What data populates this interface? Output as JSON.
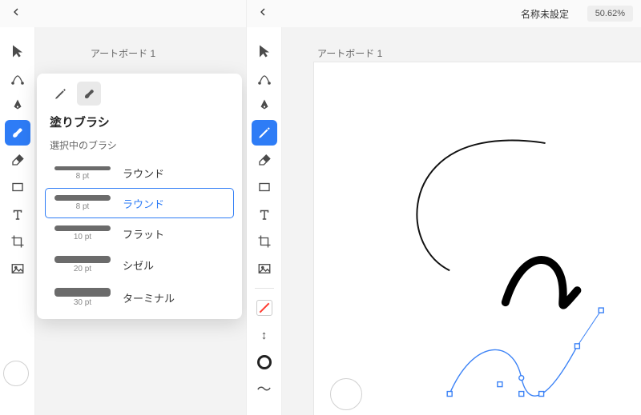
{
  "left": {
    "artboard_label": "アートボード 1",
    "toolbar": {
      "tools": [
        "selection",
        "pen-curvature",
        "pen",
        "blob-brush",
        "eraser",
        "rectangle",
        "type",
        "crop",
        "image"
      ],
      "selected": "blob-brush"
    },
    "popover": {
      "tabs": {
        "pencil": "pencil-icon",
        "blob": "blob-brush-icon",
        "active": "blob"
      },
      "title": "塗りブラシ",
      "subtitle": "選択中のブラシ",
      "brushes": [
        {
          "name": "ラウンド",
          "size": "8 pt",
          "weight": "thin",
          "selected": false
        },
        {
          "name": "ラウンド",
          "size": "8 pt",
          "weight": "mid",
          "selected": true
        },
        {
          "name": "フラット",
          "size": "10 pt",
          "weight": "mid",
          "selected": false
        },
        {
          "name": "シゼル",
          "size": "20 pt",
          "weight": "thick",
          "selected": false
        },
        {
          "name": "ターミナル",
          "size": "30 pt",
          "weight": "xthick",
          "selected": false
        }
      ]
    }
  },
  "right": {
    "doc_title": "名称未設定",
    "zoom": "50.62%",
    "artboard_label": "アートボード 1",
    "toolbar": {
      "tools": [
        "selection",
        "pen-curvature",
        "pen",
        "pencil",
        "eraser",
        "rectangle",
        "type",
        "crop",
        "image"
      ],
      "selected": "pencil",
      "extras": [
        "stroke-swatch",
        "arrows-vertical",
        "ring",
        "tilde"
      ]
    }
  }
}
